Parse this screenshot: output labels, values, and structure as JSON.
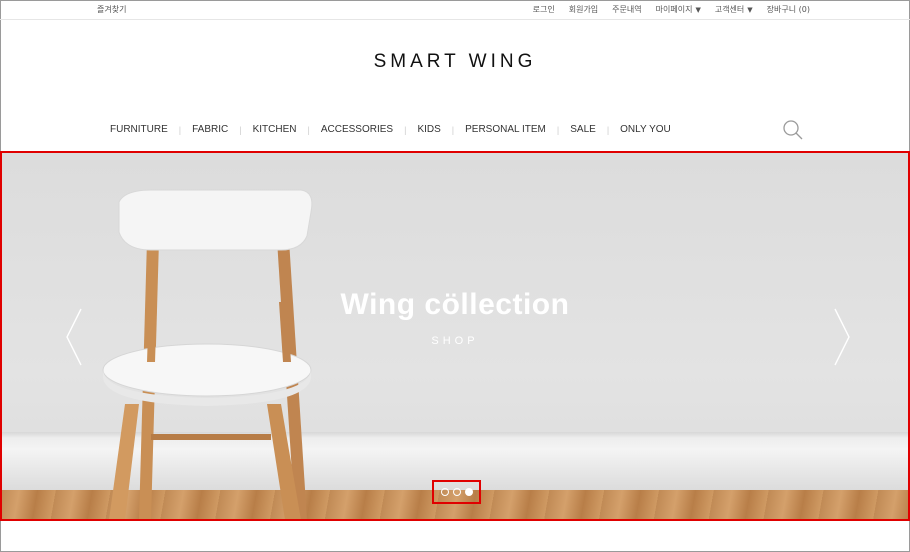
{
  "topbar": {
    "bookmark": "즐겨찾기",
    "links": {
      "login": "로그인",
      "signup": "회원가입",
      "orders": "주문내역",
      "mypage": "마이페이지",
      "support": "고객센터",
      "cart": "장바구니 (0)"
    }
  },
  "logo": "SMART WING",
  "nav": [
    "FURNITURE",
    "FABRIC",
    "KITCHEN",
    "ACCESSORIES",
    "KIDS",
    "PERSONAL ITEM",
    "SALE",
    "ONLY YOU"
  ],
  "hero": {
    "title": "Wing cöllection",
    "subtitle": "SHOP",
    "slides_total": 3,
    "active_slide": 3
  },
  "icons": {
    "search": "search-icon",
    "prev": "chevron-left-icon",
    "next": "chevron-right-icon",
    "dropdown": "caret-down-icon"
  },
  "colors": {
    "highlight": "#e00000",
    "chair_wood": "#c98f55",
    "chair_seat": "#f7f7f7"
  }
}
